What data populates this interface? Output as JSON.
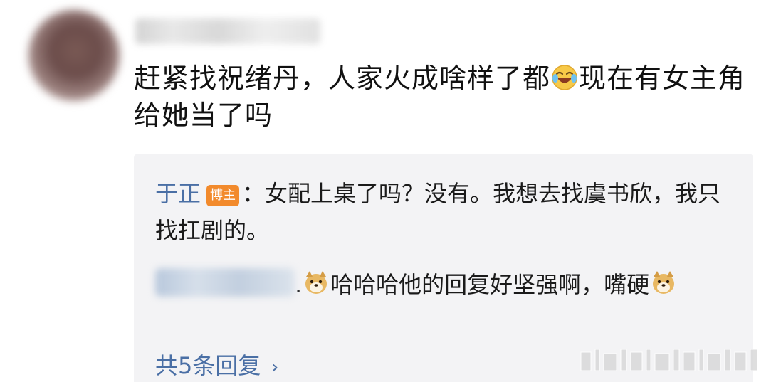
{
  "comment": {
    "text_part1": "赶紧找祝绪丹，人家火成啥样了都",
    "emoji1": "laugh-cry-emoji",
    "text_part2": "现在有女主角给她当了吗"
  },
  "replies": {
    "first": {
      "author": "于正",
      "badge": "博主",
      "text": "：女配上桌了吗？没有。我想去找虞书欣，我只找扛剧的。"
    },
    "second": {
      "text_part1": "哈哈哈他的回复好坚强啊，嘴硬",
      "emoji": "doge-emoji"
    },
    "more_label": "共5条回复"
  },
  "colors": {
    "link_blue": "#4a6fa5",
    "badge_orange": "#f28a2c",
    "panel_bg": "#f3f3f5"
  }
}
